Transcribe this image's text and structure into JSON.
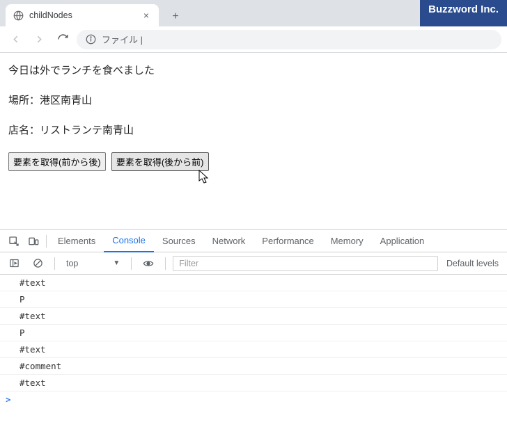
{
  "brand": "Buzzword Inc.",
  "brand_bg": "#2a4b8d",
  "tab": {
    "title": "childNodes"
  },
  "omnibox": {
    "text": "ファイル |"
  },
  "page": {
    "p1": "今日は外でランチを食べました",
    "p2": "場所：港区南青山",
    "p3": "店名：リストランテ南青山",
    "btn1": "要素を取得(前から後)",
    "btn2": "要素を取得(後から前)"
  },
  "devtools": {
    "tabs": {
      "elements": "Elements",
      "console": "Console",
      "sources": "Sources",
      "network": "Network",
      "performance": "Performance",
      "memory": "Memory",
      "application": "Application"
    },
    "context": "top",
    "filter_placeholder": "Filter",
    "levels": "Default levels",
    "lines": [
      "#text",
      "P",
      "#text",
      "P",
      "#text",
      "#comment",
      "#text"
    ],
    "prompt": ">"
  }
}
